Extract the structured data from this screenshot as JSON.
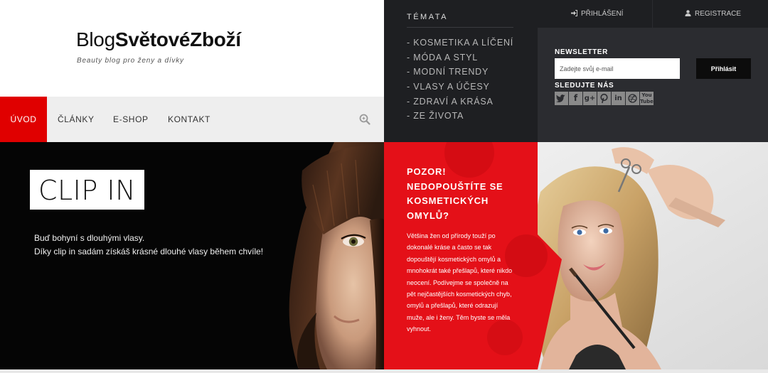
{
  "brand": {
    "logo_light": "Blog",
    "logo_bold": "SvětovéZboží",
    "tagline": "Beauty blog pro ženy a dívky"
  },
  "nav": {
    "items": [
      {
        "label": "ÚVOD",
        "active": true
      },
      {
        "label": "ČLÁNKY",
        "active": false
      },
      {
        "label": "E-SHOP",
        "active": false
      },
      {
        "label": "KONTAKT",
        "active": false
      }
    ],
    "search_icon": "search-icon"
  },
  "topics": {
    "heading": "TÉMATA",
    "items": [
      "- KOSMETIKA A LÍČENÍ",
      "- MÓDA A STYL",
      "- MODNÍ TRENDY",
      "- VLASY A ÚČESY",
      "- ZDRAVÍ A KRÁSA",
      "- ZE ŽIVOTA"
    ]
  },
  "auth": {
    "login_label": "PŘIHLÁŠENÍ",
    "login_icon": "sign-in-icon",
    "register_label": "REGISTRACE",
    "register_icon": "user-icon"
  },
  "newsletter": {
    "heading": "NEWSLETTER",
    "placeholder": "Zadejte svůj e-mail",
    "button_label": "Přihlásit"
  },
  "follow": {
    "heading": "SLEDUJTE NÁS",
    "icons": [
      "twitter-icon",
      "facebook-icon",
      "google-plus-icon",
      "pinterest-icon",
      "linkedin-icon",
      "dribbble-icon",
      "youtube-icon"
    ]
  },
  "hero": {
    "title": "CLIP IN",
    "line1": "Buď bohyní s dlouhými vlasy.",
    "line2": "Díky clip in sadám získáš krásné dlouhé vlasy během chvíle!"
  },
  "article": {
    "title": "POZOR! NEDOPOUŠTÍTE SE KOSMETICKÝCH OMYLŮ?",
    "text": "Většina žen od přírody touží po dokonalé kráse a často se tak dopouštějí kosmetických omylů a mnohokrát také přešlapů, které nikdo neocení. Podívejme se společně na pět nejčastějších kosmetických chyb, omylů a přešlapů, které odrazují muže, ale i ženy. Těm byste se měla vyhnout."
  },
  "colors": {
    "accent_red": "#e00000",
    "dark_panel": "#1e1f22",
    "right_panel": "#2b2c30",
    "nav_bg": "#eeeeee"
  }
}
